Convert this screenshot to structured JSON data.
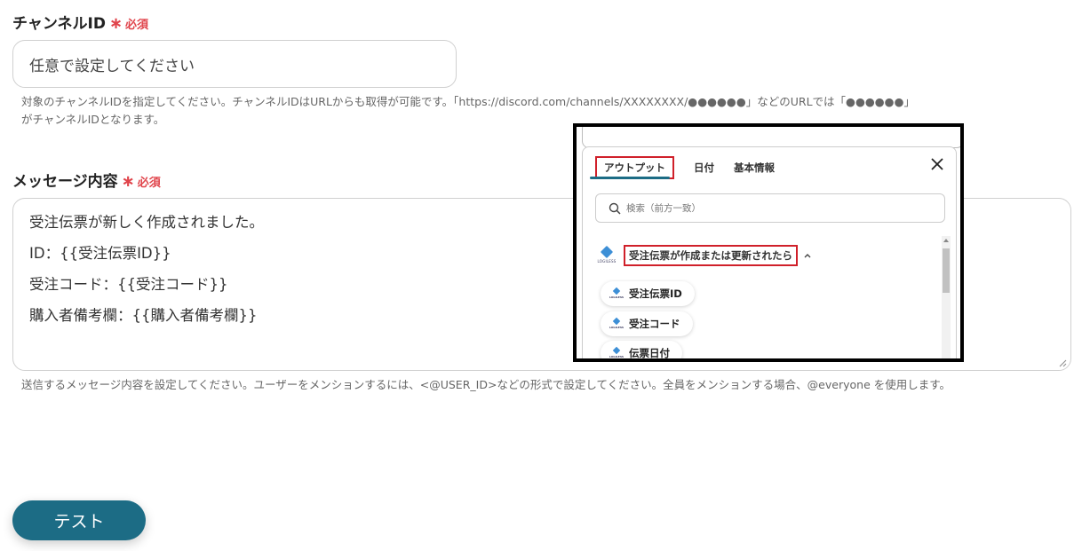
{
  "channel": {
    "label": "チャンネルID",
    "required_star": "∗",
    "required_text": "必須",
    "placeholder": "任意で設定してください",
    "help_line1": "対象のチャンネルIDを指定してください。チャンネルIDはURLからも取得が可能です。「https://discord.com/channels/XXXXXXXX/●●●●●●」などのURLでは「●●●●●●」",
    "help_line2": "がチャンネルIDとなります。"
  },
  "message": {
    "label": "メッセージ内容",
    "required_star": "∗",
    "required_text": "必須",
    "lines": [
      "受注伝票が新しく作成されました。",
      "ID：{{受注伝票ID}}",
      "受注コード：{{受注コード}}",
      "購入者備考欄：{{購入者備考欄}}"
    ],
    "help": "送信するメッセージ内容を設定してください。ユーザーをメンションするには、<@USER_ID>などの形式で設定してください。全員をメンションする場合、@everyone を使用します。"
  },
  "test_button": "テスト",
  "overlay": {
    "tabs": [
      "アウトプット",
      "日付",
      "基本情報"
    ],
    "search_placeholder": "検索（前方一致）",
    "logo_text": "LOGILESS",
    "section_title": "受注伝票が作成または更新されたら",
    "chips": [
      "受注伝票ID",
      "受注コード",
      "伝票日付"
    ]
  },
  "colors": {
    "accent": "#1c6c85",
    "required": "#e0444b",
    "highlight_border": "#d0202a"
  }
}
